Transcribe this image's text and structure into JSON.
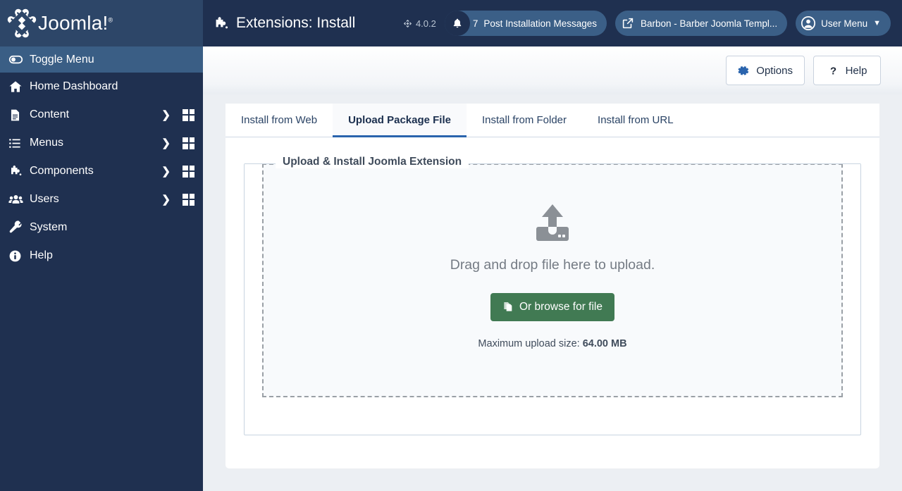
{
  "brand": {
    "name": "Joomla!",
    "registered_mark": "®",
    "logo_icon": "joomla-logo-icon"
  },
  "sidebar": {
    "items": [
      {
        "label": "Toggle Menu",
        "icon": "toggle-icon",
        "active": true,
        "has_chevron": false,
        "has_grid": false
      },
      {
        "label": "Home Dashboard",
        "icon": "home-icon",
        "active": false,
        "has_chevron": false,
        "has_grid": false
      },
      {
        "label": "Content",
        "icon": "document-icon",
        "active": false,
        "has_chevron": true,
        "has_grid": true
      },
      {
        "label": "Menus",
        "icon": "list-icon",
        "active": false,
        "has_chevron": true,
        "has_grid": true
      },
      {
        "label": "Components",
        "icon": "puzzle-icon",
        "active": false,
        "has_chevron": true,
        "has_grid": true
      },
      {
        "label": "Users",
        "icon": "users-icon",
        "active": false,
        "has_chevron": true,
        "has_grid": true
      },
      {
        "label": "System",
        "icon": "wrench-icon",
        "active": false,
        "has_chevron": false,
        "has_grid": false
      },
      {
        "label": "Help",
        "icon": "info-circle-icon",
        "active": false,
        "has_chevron": false,
        "has_grid": false
      }
    ]
  },
  "header": {
    "title": "Extensions: Install",
    "title_icon": "puzzle-icon",
    "version": "4.0.2",
    "version_icon": "joomla-mark-icon",
    "messages_pill": {
      "icon": "bell-icon",
      "count": "7",
      "label": "Post Installation Messages"
    },
    "site_pill": {
      "icon": "external-link-icon",
      "label": "Barbon - Barber Joomla Templ..."
    },
    "user_pill": {
      "icon": "user-circle-icon",
      "label": "User Menu",
      "caret": "chevron-down-icon"
    }
  },
  "toolbar": {
    "options_label": "Options",
    "options_icon": "gear-icon",
    "help_label": "Help",
    "help_icon": "question-mark-icon"
  },
  "tabs": [
    {
      "label": "Install from Web",
      "active": false
    },
    {
      "label": "Upload Package File",
      "active": true
    },
    {
      "label": "Install from Folder",
      "active": false
    },
    {
      "label": "Install from URL",
      "active": false
    }
  ],
  "upload_panel": {
    "legend": "Upload & Install Joomla Extension",
    "dropzone_icon": "upload-icon",
    "dropzone_text": "Drag and drop file here to upload.",
    "browse_button": {
      "label": "Or browse for file",
      "icon": "copy-files-icon"
    },
    "max_size_prefix": "Maximum upload size: ",
    "max_size_value": "64.00 MB"
  },
  "colors": {
    "sidebar_bg": "#1f3050",
    "sidebar_logo_bg": "#2d4668",
    "sidebar_active": "#3a5e85",
    "header_bg": "#1f3050",
    "pill_bg": "#3b5f87",
    "tab_active_underline": "#2a64ad",
    "browse_button_bg": "#417a53",
    "page_bg": "#eceff3",
    "dropzone_border": "#9aa0a6"
  }
}
